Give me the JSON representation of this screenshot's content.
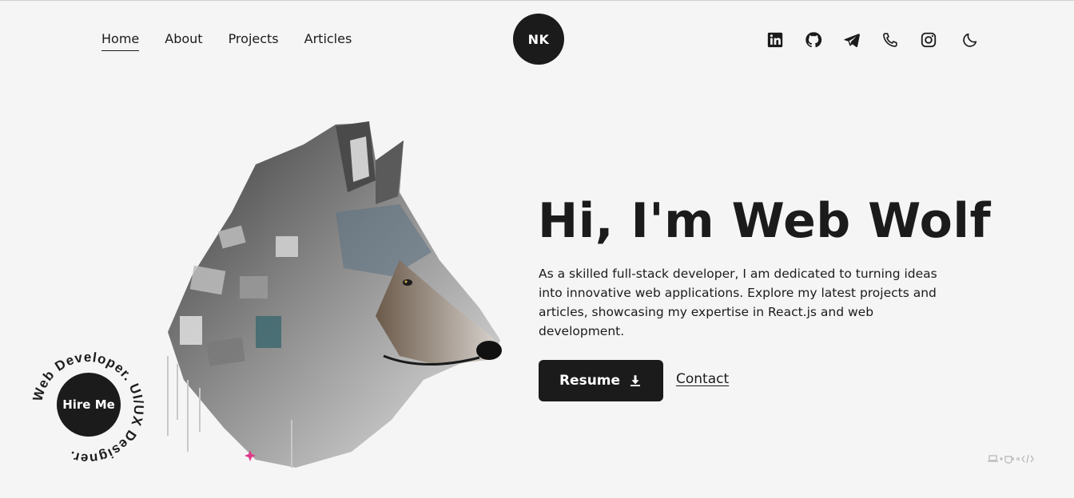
{
  "nav": {
    "links": [
      {
        "label": "Home",
        "active": true
      },
      {
        "label": "About",
        "active": false
      },
      {
        "label": "Projects",
        "active": false
      },
      {
        "label": "Articles",
        "active": false
      }
    ]
  },
  "logo": {
    "initials": "NK"
  },
  "social": [
    "linkedin-icon",
    "github-icon",
    "telegram-icon",
    "phone-icon",
    "instagram-icon",
    "moon-icon"
  ],
  "hero": {
    "title": "Hi, I'm Web Wolf",
    "description": "As a skilled full-stack developer, I am dedicated to turning ideas into innovative web applications. Explore my latest projects and articles, showcasing my expertise in React.js and web development.",
    "resume_label": "Resume",
    "contact_label": "Contact"
  },
  "hire": {
    "label": "Hire Me",
    "ring_text": "Web Developer. UI/UX Designer."
  },
  "colors": {
    "dark": "#1b1b1b",
    "background": "#f5f5f5",
    "accent": "#e0388a"
  }
}
